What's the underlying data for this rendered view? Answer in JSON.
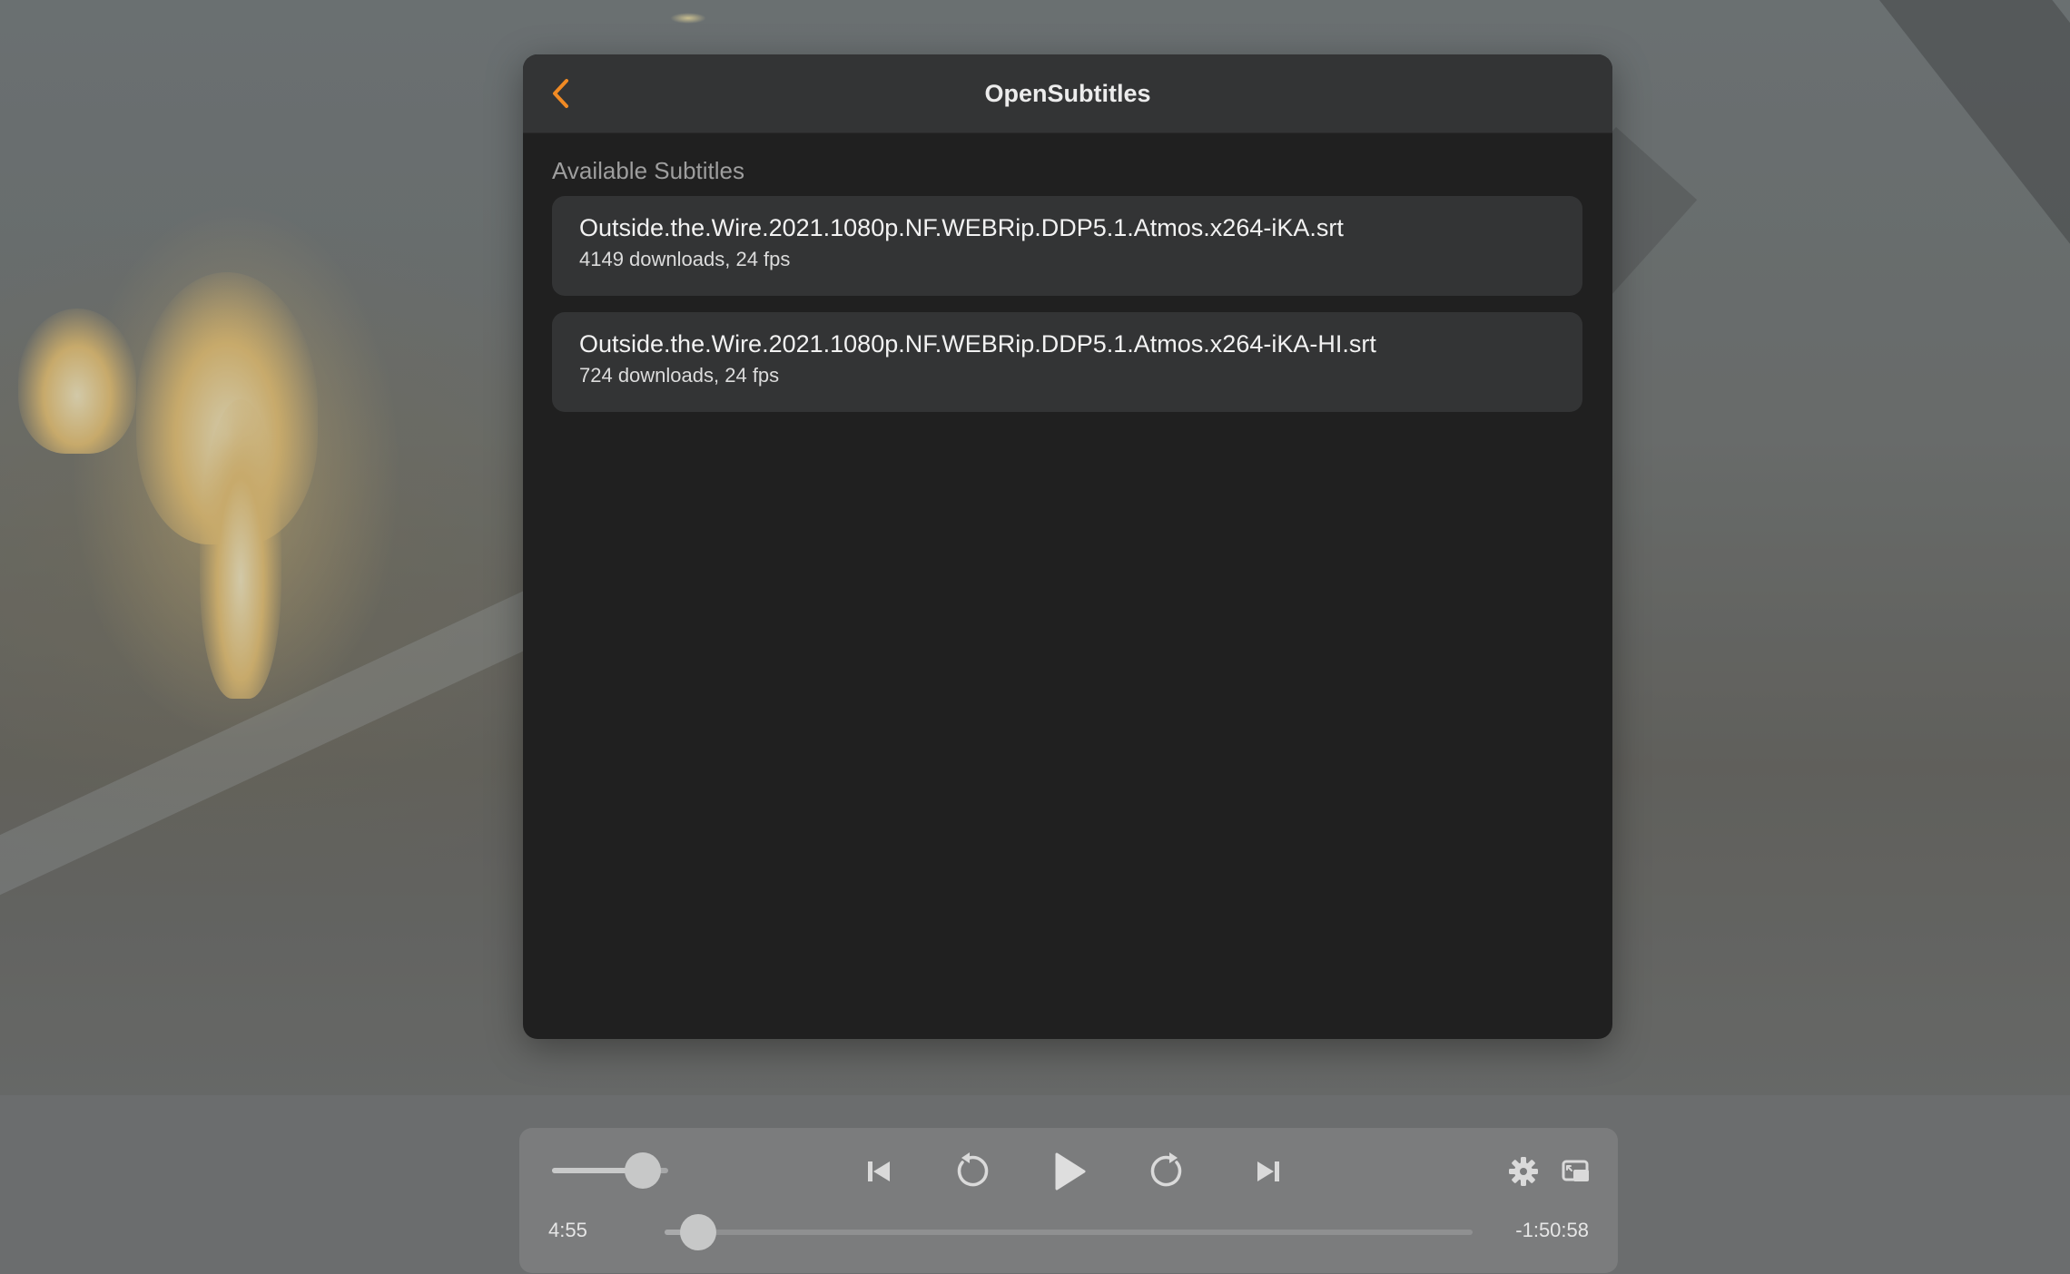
{
  "panel": {
    "title": "OpenSubtitles",
    "section_label": "Available Subtitles",
    "accent_color": "#f08a24",
    "subtitles": [
      {
        "name": "Outside.the.Wire.2021.1080p.NF.WEBRip.DDP5.1.Atmos.x264-iKA.srt",
        "meta": "4149 downloads, 24 fps"
      },
      {
        "name": "Outside.the.Wire.2021.1080p.NF.WEBRip.DDP5.1.Atmos.x264-iKA-HI.srt",
        "meta": "724 downloads, 24 fps"
      }
    ]
  },
  "player": {
    "time_elapsed": "4:55",
    "time_remaining": "-1:50:58",
    "progress_fraction": 0.042,
    "volume_fraction": 0.78,
    "icons": {
      "back": "chevron-left-icon",
      "previous": "skip-back-icon",
      "rewind": "rewind-icon",
      "play": "play-icon",
      "forward": "forward-icon",
      "next": "skip-forward-icon",
      "settings": "gear-icon",
      "pip": "picture-in-picture-icon"
    }
  }
}
